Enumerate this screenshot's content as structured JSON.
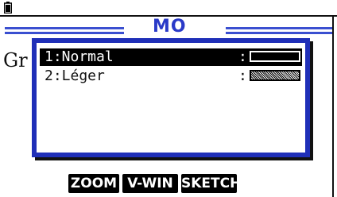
{
  "status_bar": {
    "battery_icon": "battery-icon"
  },
  "title": {
    "text": "MO"
  },
  "background_text": "Gr",
  "dialog": {
    "options": [
      {
        "label": "1:Normal",
        "colon": ":",
        "style": "solid-black"
      },
      {
        "label": "2:Léger",
        "colon": ":",
        "style": "dotted-gray"
      }
    ],
    "selected_index": 0
  },
  "function_keys": [
    {
      "label": "ZOOM"
    },
    {
      "label": "V-WIN"
    },
    {
      "label": "SKETCH"
    }
  ],
  "colors": {
    "accent": "#2a3ac8",
    "dialog_border": "#1f2fb8"
  }
}
